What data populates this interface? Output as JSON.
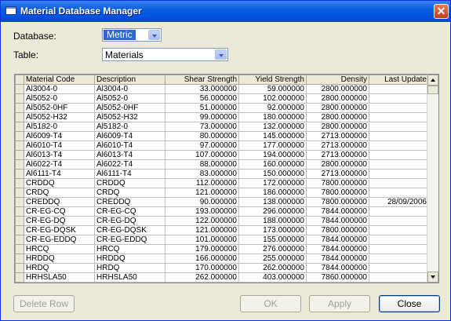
{
  "window": {
    "title": "Material Database Manager",
    "close_glyph": "✕"
  },
  "database": {
    "label": "Database:",
    "value": "Metric"
  },
  "table": {
    "label": "Table:",
    "value": "Materials"
  },
  "grid": {
    "columns": [
      "Material Code",
      "Description",
      "Shear Strength",
      "Yield Strength",
      "Density",
      "Last Update"
    ],
    "rows": [
      [
        "Al3004-0",
        "Al3004-0",
        "33.000000",
        "59.000000",
        "2800.000000",
        ""
      ],
      [
        "Al5052-0",
        "Al5052-0",
        "56.000000",
        "102.000000",
        "2800.000000",
        ""
      ],
      [
        "Al5052-0HF",
        "Al5052-0HF",
        "51.000000",
        "92.000000",
        "2800.000000",
        ""
      ],
      [
        "Al5052-H32",
        "Al5052-H32",
        "99.000000",
        "180.000000",
        "2800.000000",
        ""
      ],
      [
        "Al5182-0",
        "Al5182-0",
        "73.000000",
        "132.000000",
        "2800.000000",
        ""
      ],
      [
        "Al6009-T4",
        "Al6009-T4",
        "80.000000",
        "145.000000",
        "2713.000000",
        ""
      ],
      [
        "Al6010-T4",
        "Al6010-T4",
        "97.000000",
        "177.000000",
        "2713.000000",
        ""
      ],
      [
        "Al6013-T4",
        "Al6013-T4",
        "107.000000",
        "194.000000",
        "2713.000000",
        ""
      ],
      [
        "Al6022-T4",
        "Al6022-T4",
        "88.000000",
        "160.000000",
        "2800.000000",
        ""
      ],
      [
        "Al6111-T4",
        "Al6111-T4",
        "83.000000",
        "150.000000",
        "2713.000000",
        ""
      ],
      [
        "CRDDQ",
        "CRDDQ",
        "112.000000",
        "172.000000",
        "7800.000000",
        ""
      ],
      [
        "CRDQ",
        "CRDQ",
        "121.000000",
        "186.000000",
        "7800.000000",
        ""
      ],
      [
        "CREDDQ",
        "CREDDQ",
        "90.000000",
        "138.000000",
        "7800.000000",
        "28/09/2006"
      ],
      [
        "CR-EG-CQ",
        "CR-EG-CQ",
        "193.000000",
        "296.000000",
        "7844.000000",
        ""
      ],
      [
        "CR-EG-DQ",
        "CR-EG-DQ",
        "122.000000",
        "188.000000",
        "7844.000000",
        ""
      ],
      [
        "CR-EG-DQSK",
        "CR-EG-DQSK",
        "121.000000",
        "173.000000",
        "7800.000000",
        ""
      ],
      [
        "CR-EG-EDDQ",
        "CR-EG-EDDQ",
        "101.000000",
        "155.000000",
        "7844.000000",
        ""
      ],
      [
        "HRCQ",
        "HRCQ",
        "179.000000",
        "276.000000",
        "7844.000000",
        ""
      ],
      [
        "HRDDQ",
        "HRDDQ",
        "166.000000",
        "255.000000",
        "7844.000000",
        ""
      ],
      [
        "HRDQ",
        "HRDQ",
        "170.000000",
        "262.000000",
        "7844.000000",
        ""
      ],
      [
        "HRHSLA50",
        "HRHSLA50",
        "262.000000",
        "403.000000",
        "7860.000000",
        ""
      ]
    ]
  },
  "buttons": {
    "delete_row": "Delete Row",
    "ok": "OK",
    "apply": "Apply",
    "close": "Close"
  },
  "colors": {
    "title_bar": "#0054e3",
    "selection": "#316ac5",
    "window_bg": "#ece9d8"
  }
}
